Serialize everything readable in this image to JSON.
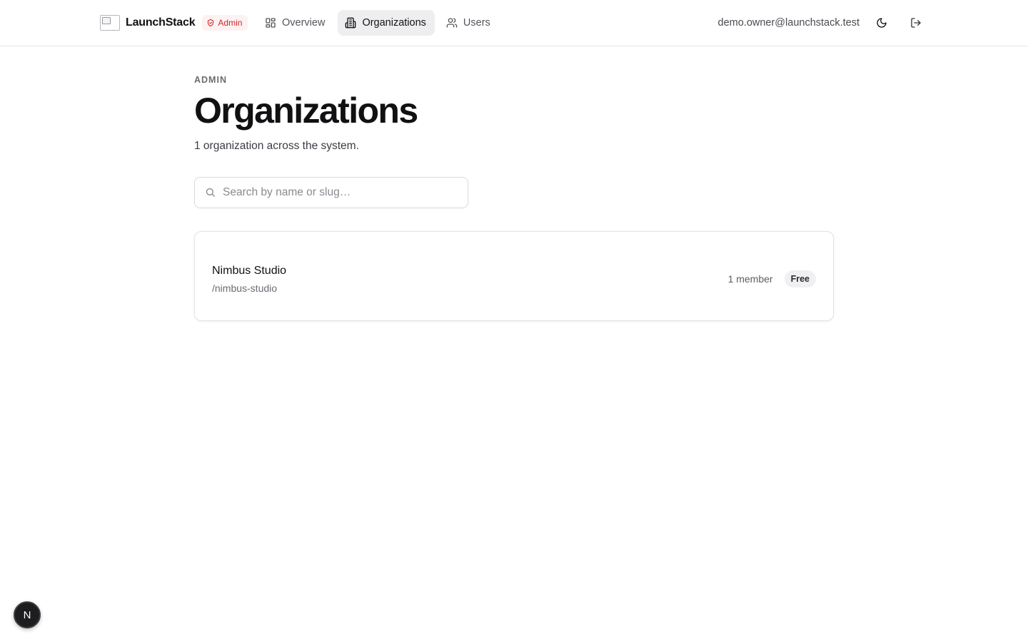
{
  "header": {
    "brand_name": "LaunchStack",
    "admin_badge": "Admin",
    "nav": [
      {
        "label": "Overview",
        "icon": "grid-icon",
        "active": false
      },
      {
        "label": "Organizations",
        "icon": "building-icon",
        "active": true
      },
      {
        "label": "Users",
        "icon": "users-icon",
        "active": false
      }
    ],
    "user_email": "demo.owner@launchstack.test"
  },
  "main": {
    "eyebrow": "ADMIN",
    "title": "Organizations",
    "subtitle": "1 organization across the system.",
    "search": {
      "placeholder": "Search by name or slug…",
      "value": ""
    },
    "organizations": [
      {
        "name": "Nimbus Studio",
        "slug": "/nimbus-studio",
        "members": "1 member",
        "plan": "Free"
      }
    ]
  },
  "dev_badge": "N",
  "colors": {
    "accent_red": "#c92a2a",
    "active_nav_bg": "#eeeef0",
    "text": "#111113"
  }
}
